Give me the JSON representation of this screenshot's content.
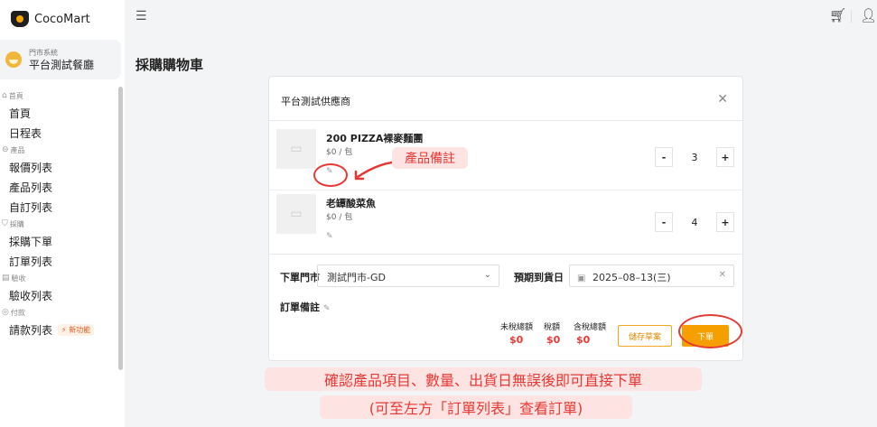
{
  "app": {
    "name": "CocoMart"
  },
  "store": {
    "system_label": "門市系統",
    "name": "平台測試餐廳"
  },
  "sidebar": {
    "groups": [
      {
        "label": "首頁",
        "items": [
          {
            "label": "首頁"
          },
          {
            "label": "日程表"
          }
        ]
      },
      {
        "label": "產品",
        "items": [
          {
            "label": "報價列表"
          },
          {
            "label": "產品列表"
          },
          {
            "label": "自訂列表"
          }
        ]
      },
      {
        "label": "採購",
        "items": [
          {
            "label": "採購下單"
          },
          {
            "label": "訂單列表"
          }
        ]
      },
      {
        "label": "驗收",
        "items": [
          {
            "label": "驗收列表"
          }
        ]
      },
      {
        "label": "付款",
        "items": [
          {
            "label": "請款列表",
            "badge": "新功能"
          }
        ]
      }
    ]
  },
  "page": {
    "title": "採購購物車"
  },
  "cart": {
    "supplier": "平台測試供應商",
    "products": [
      {
        "name": "200 PIZZA裸麥麵團",
        "price": "$0 / 包",
        "qty": "3"
      },
      {
        "name": "老罈酸菜魚",
        "price": "$0 / 包",
        "qty": "4"
      }
    ],
    "store_label": "下單門市",
    "store_value": "測試門市-GD",
    "eta_label": "預期到貨日",
    "eta_value": "2025–08–13(三)",
    "note_label": "訂單備註",
    "totals": {
      "pretax_label": "未稅總額",
      "pretax": "$0",
      "tax_label": "稅額",
      "tax": "$0",
      "total_label": "含稅總額",
      "total": "$0"
    },
    "save_draft": "儲存草案",
    "place_order": "下單"
  },
  "annotations": {
    "note1": "產品備註",
    "note2_line1": "確認產品項目、數量、出貨日無誤後即可直接下單",
    "note2_line2": "(可至左方「訂單列表」查看訂單)"
  },
  "colors": {
    "accent": "#f5a000",
    "annotation": "#e53935",
    "annotation_bg": "#fde3e1"
  }
}
